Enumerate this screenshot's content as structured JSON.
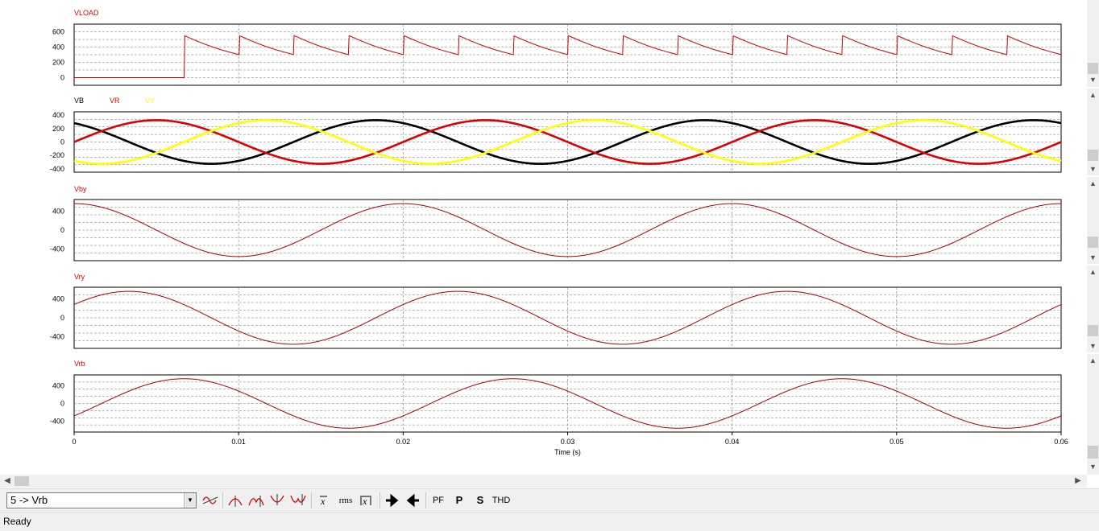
{
  "chart_data": [
    {
      "type": "line",
      "series": [
        {
          "name": "VLOAD",
          "color": "#cc0000",
          "description": "0 until ~0.0067 s, then rectifier output jumping to ~550 at each commutation and decaying to ~300 every 1/300 s"
        }
      ],
      "ylim": [
        -100,
        700
      ],
      "yticks": [
        600,
        400,
        200,
        0
      ],
      "xlim": [
        0,
        0.06
      ],
      "grid": true
    },
    {
      "type": "line",
      "series": [
        {
          "name": "VB",
          "color": "#000000",
          "amplitude": 325,
          "frequency_hz": 50,
          "phase_deg": 120
        },
        {
          "name": "VR",
          "color": "#dd0000",
          "amplitude": 325,
          "frequency_hz": 50,
          "phase_deg": 0
        },
        {
          "name": "VY",
          "color": "#ffff00",
          "amplitude": 325,
          "frequency_hz": 50,
          "phase_deg": -120
        }
      ],
      "ylim": [
        -450,
        450
      ],
      "yticks": [
        400,
        200,
        0,
        -200,
        -400
      ],
      "xlim": [
        0,
        0.06
      ],
      "grid": true
    },
    {
      "type": "line",
      "series": [
        {
          "name": "Vby",
          "color": "#aa0000",
          "amplitude": 563,
          "frequency_hz": 50,
          "phase_deg": 90
        }
      ],
      "ylim": [
        -650,
        650
      ],
      "yticks": [
        400,
        0,
        -400
      ],
      "xlim": [
        0,
        0.06
      ],
      "grid": true
    },
    {
      "type": "line",
      "series": [
        {
          "name": "Vry",
          "color": "#aa0000",
          "amplitude": 563,
          "frequency_hz": 50,
          "phase_deg": 30
        }
      ],
      "ylim": [
        -650,
        650
      ],
      "yticks": [
        400,
        0,
        -400
      ],
      "xlim": [
        0,
        0.06
      ],
      "grid": true
    },
    {
      "type": "line",
      "series": [
        {
          "name": "Vrb",
          "color": "#aa0000",
          "amplitude": 563,
          "frequency_hz": 50,
          "phase_deg": -30
        }
      ],
      "ylim": [
        -650,
        650
      ],
      "yticks": [
        400,
        0,
        -400
      ],
      "xlim": [
        0,
        0.06
      ],
      "xticks": [
        0,
        0.01,
        0.02,
        0.03,
        0.04,
        0.05,
        0.06
      ],
      "xlabel": "Time (s)",
      "grid": true
    }
  ],
  "toolbar": {
    "curve_selector_value": "5 -> Vrb",
    "rms_label": "rms",
    "pf_label": "PF",
    "p_label": "P",
    "s_label": "S",
    "thd_label": "THD"
  },
  "status": {
    "text": "Ready"
  }
}
